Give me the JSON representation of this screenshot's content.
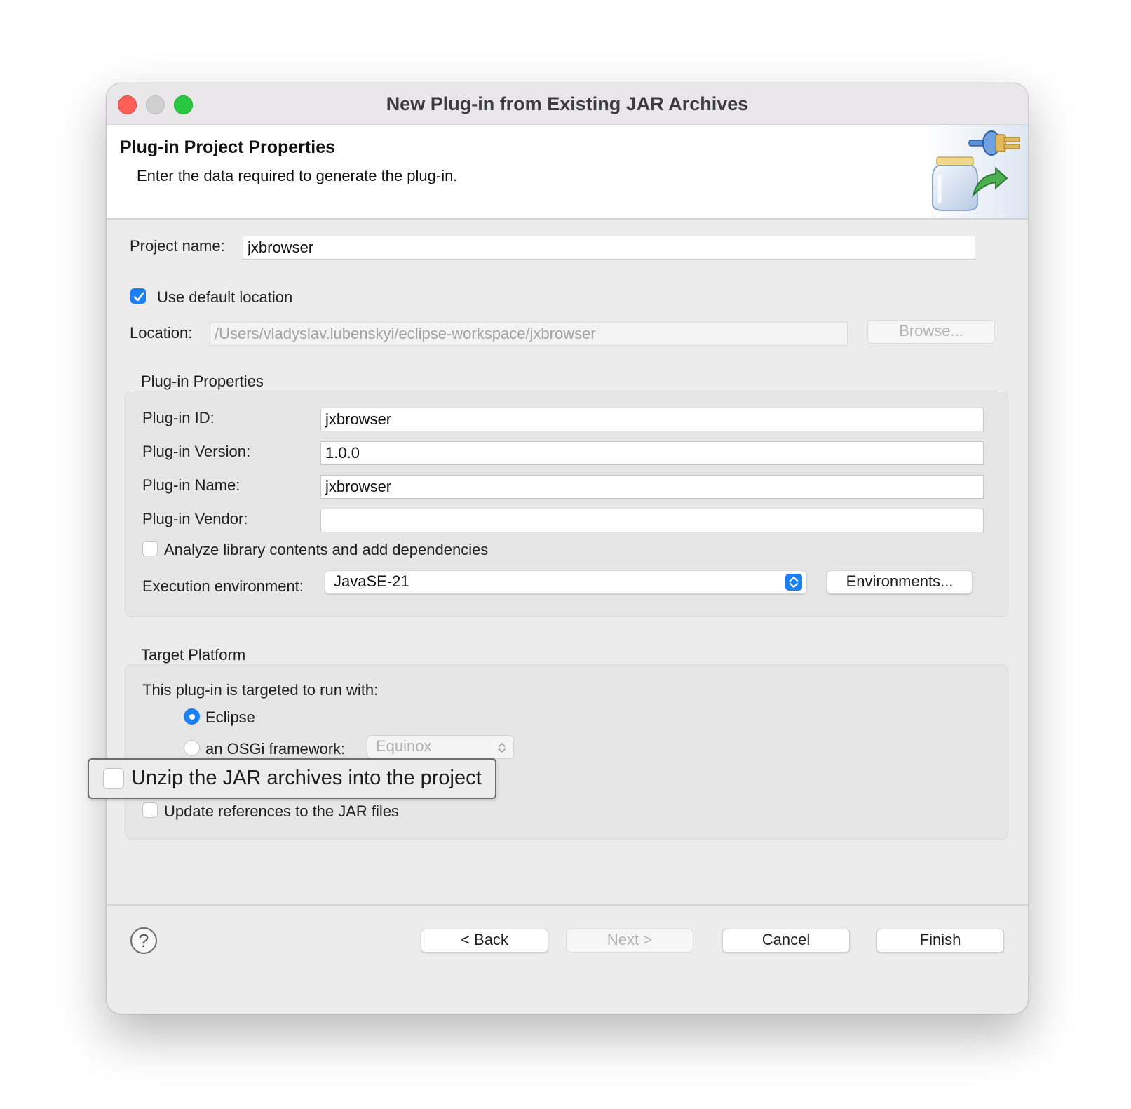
{
  "window": {
    "title": "New Plug-in from Existing JAR Archives"
  },
  "header": {
    "title": "Plug-in Project Properties",
    "description": "Enter the data required to generate the plug-in."
  },
  "project": {
    "name_label": "Project name:",
    "name_value": "jxbrowser",
    "use_default_location_label": "Use default location",
    "use_default_location_checked": true,
    "location_label": "Location:",
    "location_value": "/Users/vladyslav.lubenskyi/eclipse-workspace/jxbrowser",
    "browse_label": "Browse..."
  },
  "plugin_properties": {
    "group_label": "Plug-in Properties",
    "id_label": "Plug-in ID:",
    "id_value": "jxbrowser",
    "version_label": "Plug-in Version:",
    "version_value": "1.0.0",
    "name_label": "Plug-in Name:",
    "name_value": "jxbrowser",
    "vendor_label": "Plug-in Vendor:",
    "vendor_value": "",
    "analyze_label": "Analyze library contents and add dependencies",
    "analyze_checked": false,
    "exec_env_label": "Execution environment:",
    "exec_env_value": "JavaSE-21",
    "environments_button": "Environments..."
  },
  "target_platform": {
    "group_label": "Target Platform",
    "intro": "This plug-in is targeted to run with:",
    "eclipse_label": "Eclipse",
    "eclipse_selected": true,
    "osgi_label": "an OSGi framework:",
    "osgi_selected": false,
    "osgi_value": "Equinox",
    "unzip_label": "Unzip the JAR archives into the project",
    "unzip_checked": false,
    "update_refs_label": "Update references to the JAR files",
    "update_refs_checked": false
  },
  "footer": {
    "help": "?",
    "back": "< Back",
    "next": "Next >",
    "cancel": "Cancel",
    "finish": "Finish"
  },
  "colors": {
    "accent": "#1b7ff5",
    "close": "#ff5f57",
    "maximize": "#28c840"
  }
}
